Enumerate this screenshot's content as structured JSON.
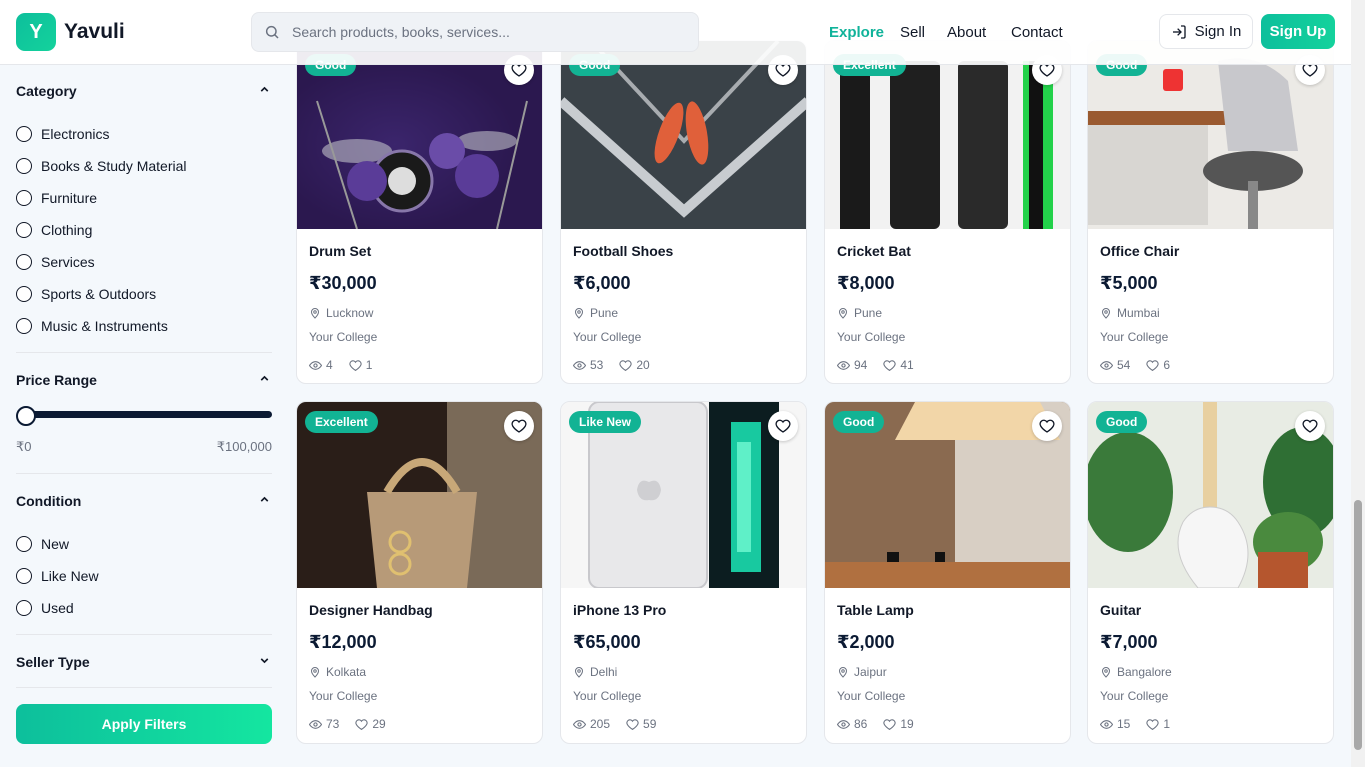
{
  "header": {
    "logo_letter": "Y",
    "brand": "Yavuli",
    "search_placeholder": "Search products, books, services...",
    "nav": [
      "Explore",
      "Sell",
      "About",
      "Contact"
    ],
    "sign_in": "Sign In",
    "sign_up": "Sign Up"
  },
  "filters": {
    "category": {
      "title": "Category",
      "options": [
        "Electronics",
        "Books & Study Material",
        "Furniture",
        "Clothing",
        "Services",
        "Sports & Outdoors",
        "Music & Instruments"
      ]
    },
    "price": {
      "title": "Price Range",
      "min": "₹0",
      "max": "₹100,000"
    },
    "condition": {
      "title": "Condition",
      "options": [
        "New",
        "Like New",
        "Used"
      ]
    },
    "seller_type": {
      "title": "Seller Type"
    },
    "apply": "Apply Filters"
  },
  "cards": [
    {
      "badge": "Good",
      "title": "Drum Set",
      "price": "₹30,000",
      "location": "Lucknow",
      "college": "Your College",
      "views": "4",
      "likes": "1"
    },
    {
      "badge": "Good",
      "title": "Football Shoes",
      "price": "₹6,000",
      "location": "Pune",
      "college": "Your College",
      "views": "53",
      "likes": "20"
    },
    {
      "badge": "Excellent",
      "title": "Cricket Bat",
      "price": "₹8,000",
      "location": "Pune",
      "college": "Your College",
      "views": "94",
      "likes": "41"
    },
    {
      "badge": "Good",
      "title": "Office Chair",
      "price": "₹5,000",
      "location": "Mumbai",
      "college": "Your College",
      "views": "54",
      "likes": "6"
    },
    {
      "badge": "Excellent",
      "title": "Designer Handbag",
      "price": "₹12,000",
      "location": "Kolkata",
      "college": "Your College",
      "views": "73",
      "likes": "29"
    },
    {
      "badge": "Like New",
      "title": "iPhone 13 Pro",
      "price": "₹65,000",
      "location": "Delhi",
      "college": "Your College",
      "views": "205",
      "likes": "59"
    },
    {
      "badge": "Good",
      "title": "Table Lamp",
      "price": "₹2,000",
      "location": "Jaipur",
      "college": "Your College",
      "views": "86",
      "likes": "19"
    },
    {
      "badge": "Good",
      "title": "Guitar",
      "price": "₹7,000",
      "location": "Bangalore",
      "college": "Your College",
      "views": "15",
      "likes": "1"
    }
  ]
}
